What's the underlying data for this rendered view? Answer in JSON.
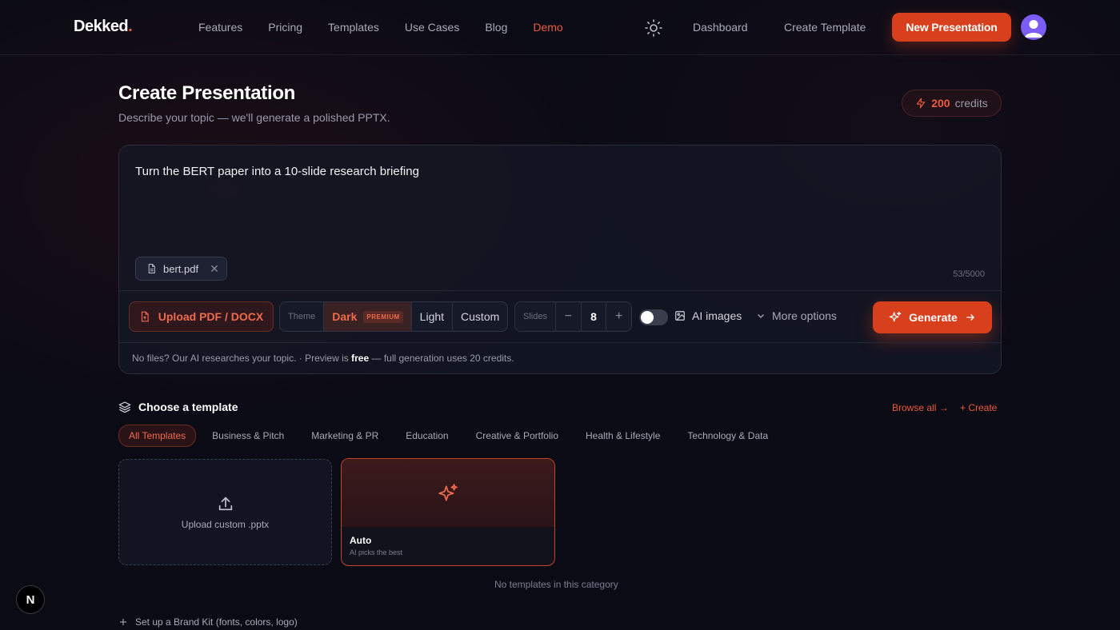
{
  "nav": {
    "logo": "Dekked",
    "logo_dot": ".",
    "links": [
      "Features",
      "Pricing",
      "Templates",
      "Use Cases",
      "Blog",
      "Demo"
    ],
    "active_link": "Demo",
    "theme_icon": "sun-icon",
    "dashboard": "Dashboard",
    "create_template": "Create Template",
    "new_presentation": "New Presentation"
  },
  "header": {
    "title": "Create Presentation",
    "subtitle": "Describe your topic — we'll generate a polished PPTX.",
    "credits_value": "200",
    "credits_label": "credits"
  },
  "composer": {
    "prompt": "Turn the BERT paper into a 10-slide research briefing",
    "file_name": "bert.pdf",
    "counter": "53/5000",
    "upload_label": "Upload PDF / DOCX",
    "theme_label": "Theme",
    "theme_options": [
      "Dark",
      "Light",
      "Custom"
    ],
    "theme_selected": "Dark",
    "premium_badge": "PREMIUM",
    "slides_label": "Slides",
    "slides_minus": "−",
    "slides_value": "8",
    "slides_plus": "+",
    "ai_images_label": "AI images",
    "ai_images_on": false,
    "more_options": "More options",
    "generate": "Generate",
    "footer_prefix": "No files? Our AI researches your topic. · Preview is",
    "footer_free": "free",
    "footer_suffix": "— full generation uses 20 credits."
  },
  "templates": {
    "title": "Choose a template",
    "browse_all": "Browse all →",
    "create": "+ Create",
    "categories": [
      "All Templates",
      "Business & Pitch",
      "Marketing & PR",
      "Education",
      "Creative & Portfolio",
      "Health & Lifestyle",
      "Technology & Data"
    ],
    "active_category": "All Templates",
    "upload_card": "Upload custom .pptx",
    "auto_name": "Auto",
    "auto_desc": "AI picks the best",
    "empty": "No templates in this category",
    "brand_kit": "Set up a Brand Kit (fonts, colors, logo)"
  },
  "badge": "N",
  "colors": {
    "accent": "#d8401d",
    "accent_text": "#ef5a3c",
    "background": "#0b0b15"
  }
}
